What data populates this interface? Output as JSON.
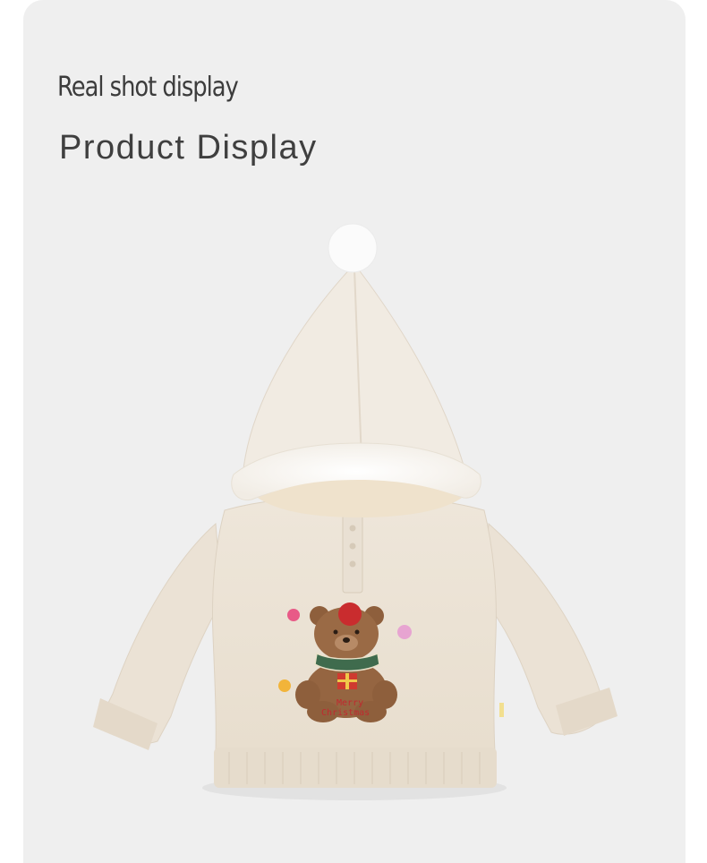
{
  "header": {
    "subtitle": "Real shot display",
    "title": "Product Display"
  },
  "product": {
    "embroidery_text_line1": "Merry",
    "embroidery_text_line2": "Christmas"
  },
  "colors": {
    "background": "#efefef",
    "garment": "#ece3d6",
    "fur_trim": "#fbf8f3",
    "bear": "#9a6a45",
    "collar": "#3f6b4d",
    "embroidery": "#c0292f"
  }
}
